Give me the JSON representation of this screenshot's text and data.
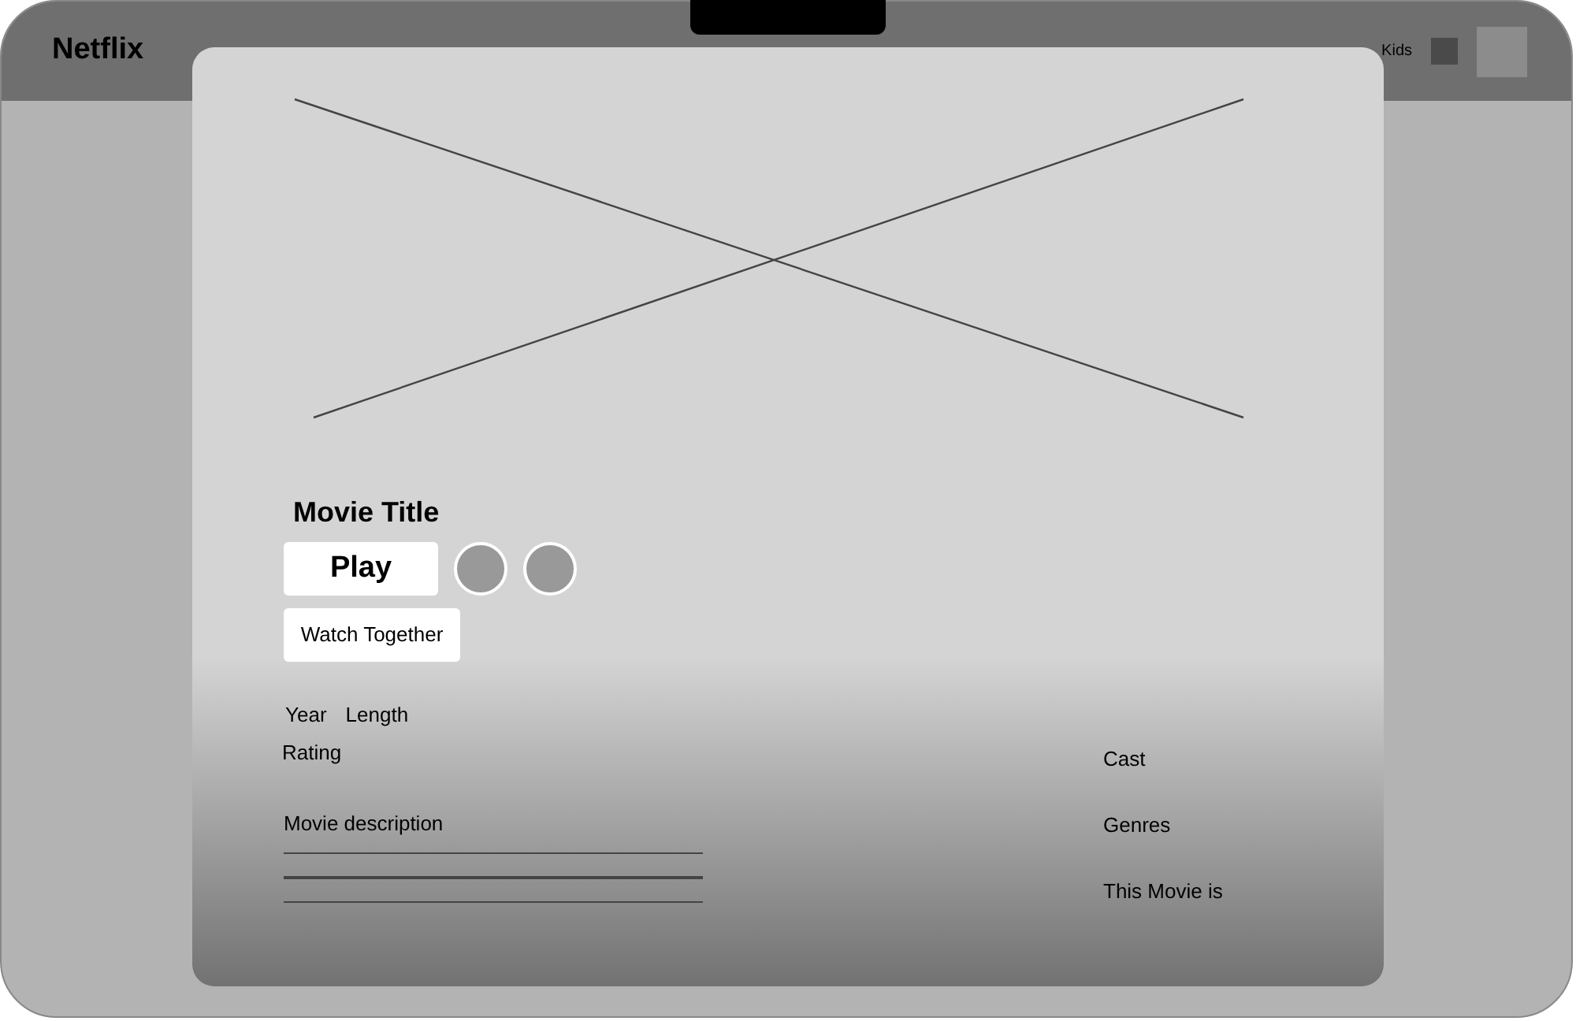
{
  "header": {
    "logo": "Netflix",
    "kids_label": "Kids"
  },
  "modal": {
    "title": "Movie Title",
    "play_button": "Play",
    "watch_together_button": "Watch Together",
    "meta": [
      "Year",
      "Length"
    ],
    "rating": "Rating",
    "description": "Movie description",
    "side_labels": [
      "Cast",
      "Genres",
      "This Movie is"
    ]
  }
}
